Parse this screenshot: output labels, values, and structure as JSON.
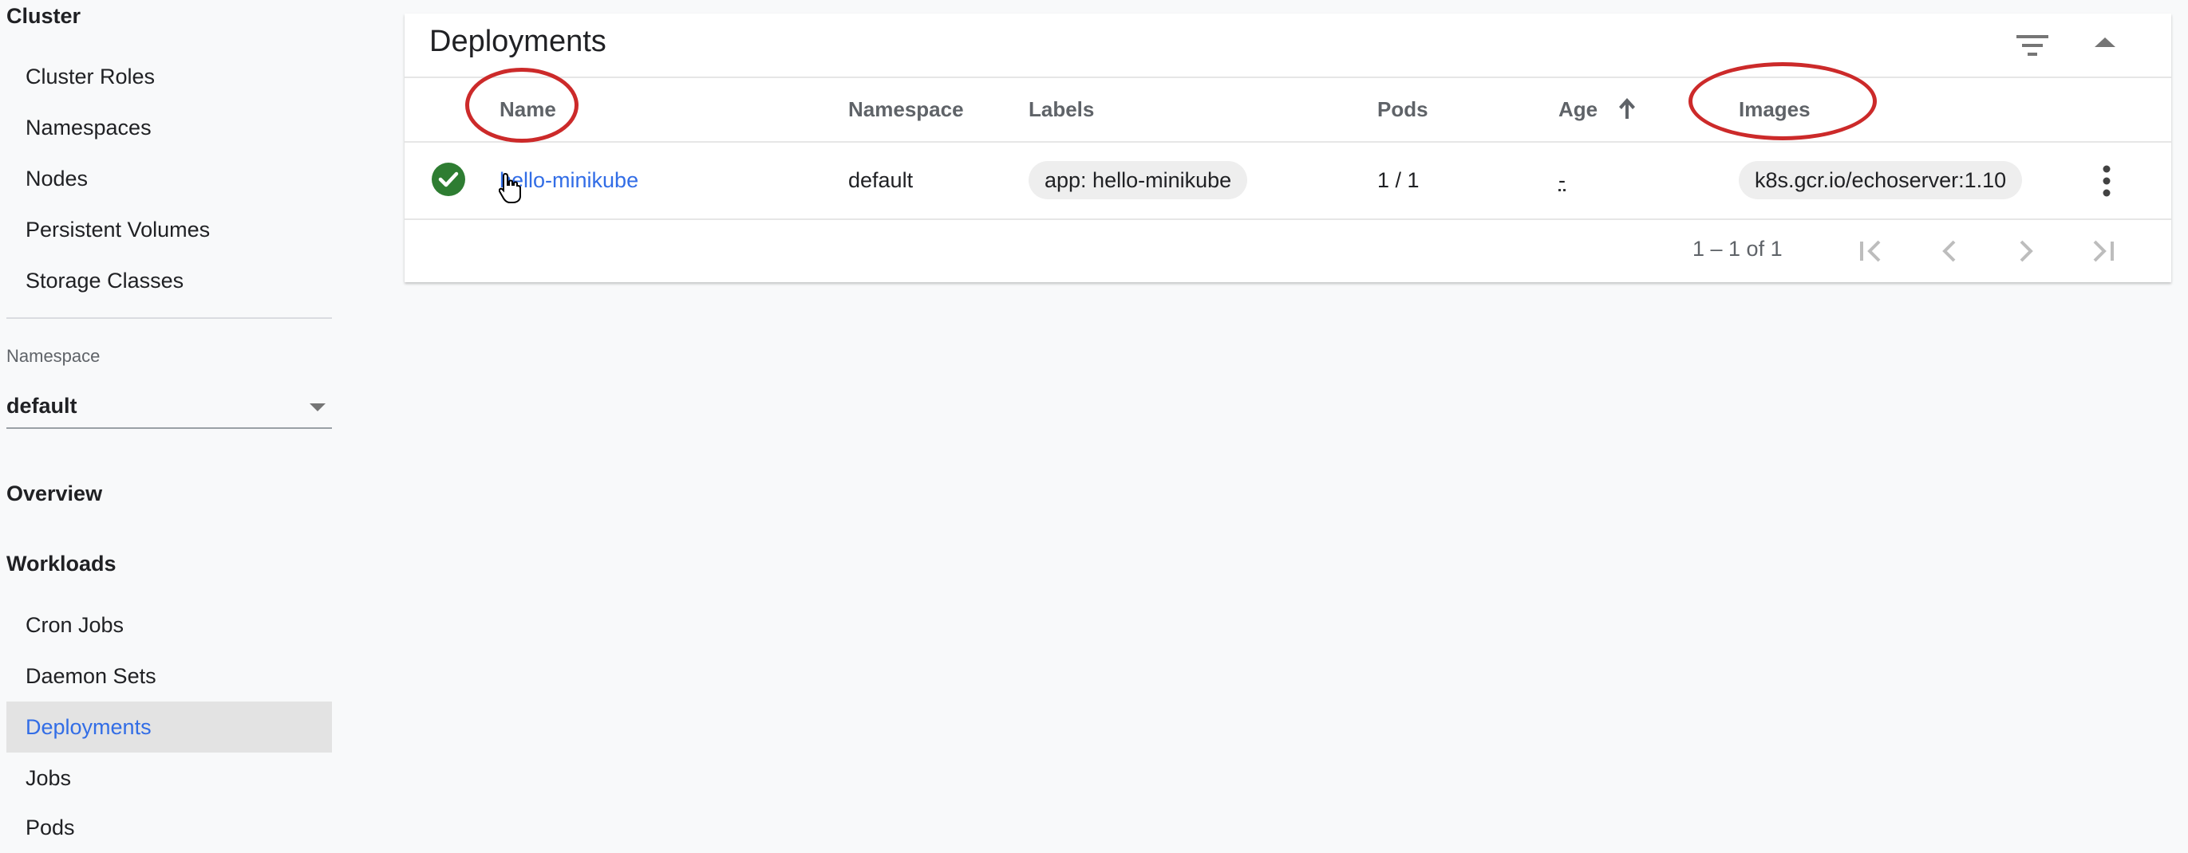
{
  "sidebar": {
    "cluster_title": "Cluster",
    "cluster_items": [
      {
        "label": "Cluster Roles"
      },
      {
        "label": "Namespaces"
      },
      {
        "label": "Nodes"
      },
      {
        "label": "Persistent Volumes"
      },
      {
        "label": "Storage Classes"
      }
    ],
    "namespace_label": "Namespace",
    "namespace_value": "default",
    "overview_title": "Overview",
    "workloads_title": "Workloads",
    "workload_items": [
      {
        "label": "Cron Jobs"
      },
      {
        "label": "Daemon Sets"
      },
      {
        "label": "Deployments",
        "active": true
      },
      {
        "label": "Jobs"
      },
      {
        "label": "Pods"
      }
    ]
  },
  "card": {
    "title": "Deployments",
    "columns": {
      "name": "Name",
      "namespace": "Namespace",
      "labels": "Labels",
      "pods": "Pods",
      "age": "Age",
      "images": "Images"
    },
    "sort": {
      "column": "Age",
      "direction": "ascending"
    },
    "rows": [
      {
        "status": "running",
        "name": "hello-minikube",
        "namespace": "default",
        "label": "app: hello-minikube",
        "pods": "1 / 1",
        "age": "-",
        "image": "k8s.gcr.io/echoserver:1.10"
      }
    ],
    "paginator": {
      "range": "1 – 1 of 1"
    }
  },
  "colors": {
    "accent": "#326de6",
    "success": "#2e7d32",
    "annotation": "#cc2a2a"
  },
  "icons": {
    "filter": "filter-icon",
    "collapse": "chevron-up-icon",
    "sort": "arrow-up-icon",
    "status": "check-circle-icon",
    "more": "more-vert-icon",
    "first_page": "first-page-icon",
    "prev_page": "chevron-left-icon",
    "next_page": "chevron-right-icon",
    "last_page": "last-page-icon",
    "namespace_dropdown": "caret-down-icon",
    "cursor": "hand-pointer-icon"
  }
}
